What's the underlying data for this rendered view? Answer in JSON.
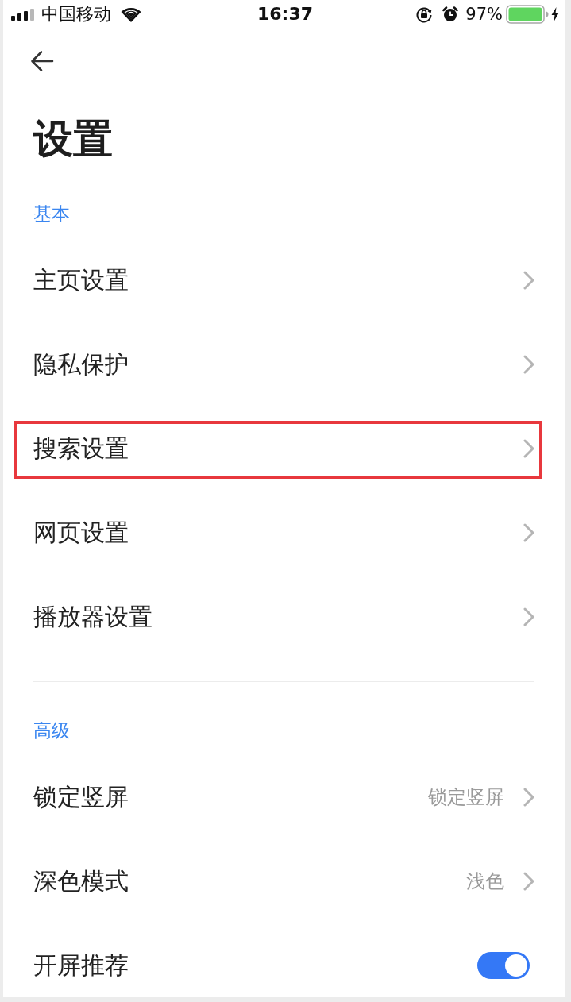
{
  "status_bar": {
    "carrier": "中国移动",
    "time": "16:37",
    "battery": "97%"
  },
  "header": {
    "title": "设置"
  },
  "sections": [
    {
      "title": "基本",
      "items": [
        {
          "label": "主页设置",
          "kind": "link",
          "highlighted": false
        },
        {
          "label": "隐私保护",
          "kind": "link",
          "highlighted": false
        },
        {
          "label": "搜索设置",
          "kind": "link",
          "highlighted": true
        },
        {
          "label": "网页设置",
          "kind": "link",
          "highlighted": false
        },
        {
          "label": "播放器设置",
          "kind": "link",
          "highlighted": false
        }
      ]
    },
    {
      "title": "高级",
      "items": [
        {
          "label": "锁定竖屏",
          "kind": "value",
          "value": "锁定竖屏",
          "highlighted": false
        },
        {
          "label": "深色模式",
          "kind": "value",
          "value": "浅色",
          "highlighted": false
        },
        {
          "label": "开屏推荐",
          "kind": "toggle",
          "on": true,
          "highlighted": false
        }
      ]
    }
  ]
}
